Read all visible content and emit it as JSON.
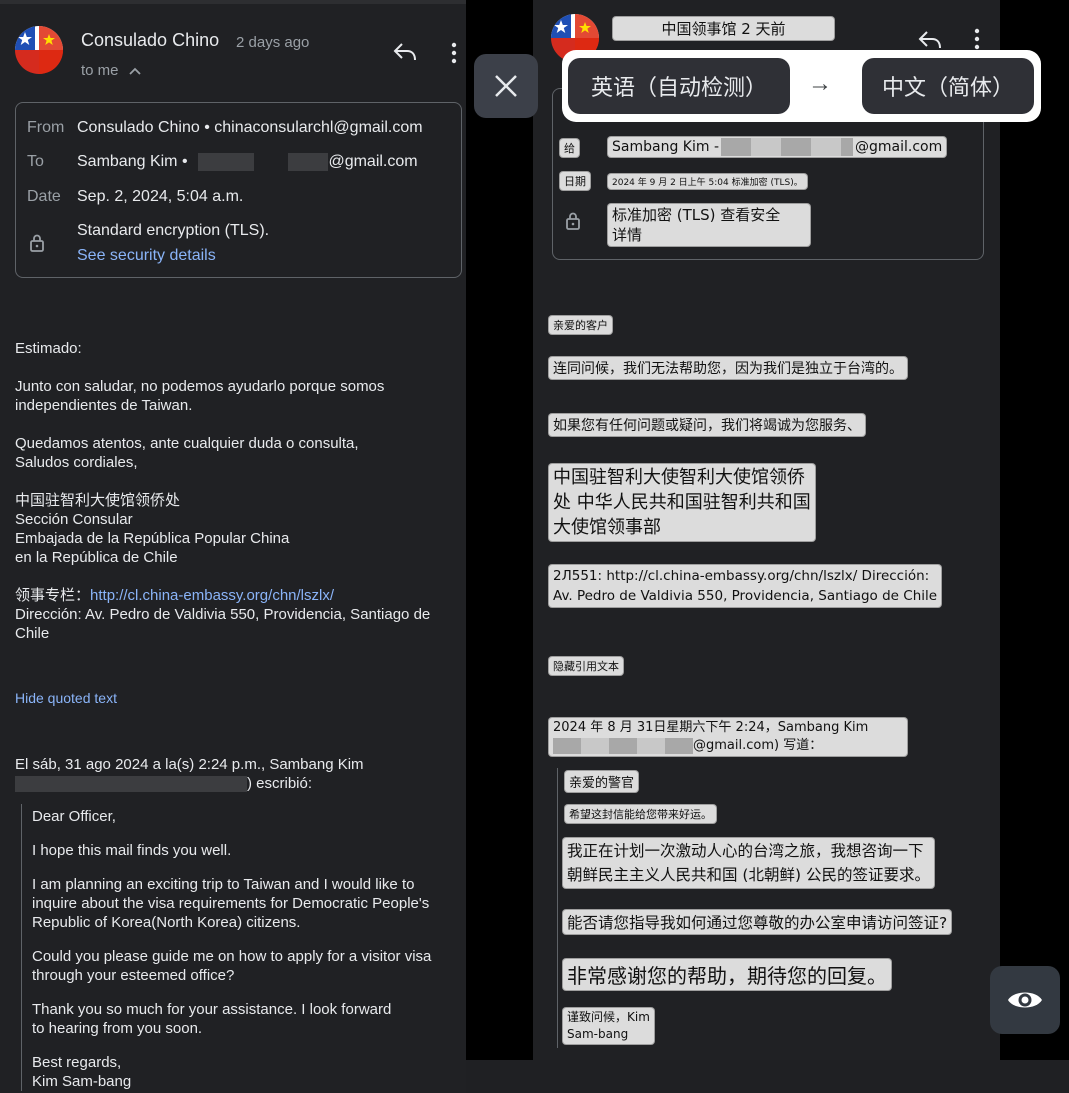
{
  "left": {
    "sender": "Consulado Chino",
    "time": "2 days ago",
    "to_me": "to me",
    "details": {
      "from_label": "From",
      "from_value": "Consulado Chino • chinaconsularchl@gmail.com",
      "to_label": "To",
      "to_name": "Sambang Kim •",
      "to_domain": "@gmail.com",
      "date_label": "Date",
      "date_value": "Sep. 2, 2024, 5:04 a.m.",
      "security_text": "Standard encryption (TLS).",
      "security_link": "See security details"
    },
    "body": {
      "greeting": "Estimado:",
      "p1_l1": "Junto con saludar, no podemos ayudarlo porque somos",
      "p1_l2": "independientes de Taiwan.",
      "p2_l1": "Quedamos atentos, ante cualquier duda o consulta,",
      "p2_l2": "Saludos cordiales,",
      "sig_1": "中国驻智利大使馆领侨处",
      "sig_2": "Sección Consular",
      "sig_3": "Embajada de la República Popular China",
      "sig_4": "en la República de Chile",
      "column_label": "领事专栏：",
      "column_link": "http://cl.china-embassy.org/chn/lszlx/",
      "address_l1": "Dirección: Av. Pedro de Valdivia 550, Providencia, Santiago de",
      "address_l2": "Chile",
      "hide_quoted": "Hide quoted text",
      "quote_header_l1": "El sáb, 31 ago 2024 a la(s) 2:24 p.m., Sambang Kim",
      "quote_header_l2": ") escribió:"
    },
    "quote": {
      "l1": "Dear Officer,",
      "l2": "I hope this mail finds you well.",
      "l3a": "I am planning an exciting trip to Taiwan and I would like to",
      "l3b": "inquire about the visa requirements for Democratic People's",
      "l3c": "Republic of Korea(North Korea) citizens.",
      "l4a": "Could you please guide me on how to apply for a visitor visa",
      "l4b": "through your esteemed office?",
      "l5a": "Thank you so much for your assistance. I look forward",
      "l5b": "to hearing from you soon.",
      "l6a": "Best regards,",
      "l6b": "Kim Sam-bang"
    }
  },
  "right": {
    "header": "中国领事馆 2 天前",
    "source_lang": "英语（自动检测）",
    "arrow": "→",
    "target_lang": "中文（简体）",
    "to_label": "给",
    "to_value_a": "Sambang Kim -",
    "to_value_b": "@gmail.com",
    "date_label": "日期",
    "date_value": "2024 年 9 月 2 日上午 5:04 标准加密 (TLS)。",
    "security_l1": "标准加密 (TLS) 查看安全",
    "security_l2": "详情",
    "greeting": "亲爱的客户",
    "p1": "连同问候，我们无法帮助您，因为我们是独立于台湾的。",
    "p2": "如果您有任何问题或疑问，我们将竭诚为您服务、",
    "sig_l1": "中国驻智利大使智利大使馆领侨",
    "sig_l2": "处 中华人民共和国驻智利共和国",
    "sig_l3": "大使馆领事部",
    "addr_l1": "2Л551: http://cl.china-embassy.org/chn/lszlx/ Dirección:",
    "addr_l2": "Av. Pedro de Valdivia 550, Providencia, Santiago de Chile",
    "hide_quoted": "隐藏引用文本",
    "quote_hdr_l1": "2024 年 8 月 31日星期六下午 2:24，Sambang Kim",
    "quote_hdr_l2": "@gmail.com) 写道：",
    "q1": "亲爱的警官",
    "q2": "希望这封信能给您带来好运。",
    "q3a": "我正在计划一次激动人心的台湾之旅，我想咨询一下",
    "q3b": "朝鲜民主主义人民共和国 (北朝鲜) 公民的签证要求。",
    "q4": "能否请您指导我如何通过您尊敬的办公室申请访问签证?",
    "q5": "非常感谢您的帮助，期待您的回复。",
    "q6a": "谨致问候，Kim",
    "q6b": "Sam-bang"
  },
  "icons": [
    "chile-china-flag-avatar",
    "reply-icon",
    "more-vert-icon",
    "chevron-up-icon",
    "lock-icon",
    "close-icon",
    "arrow-right-icon",
    "eye-icon"
  ]
}
